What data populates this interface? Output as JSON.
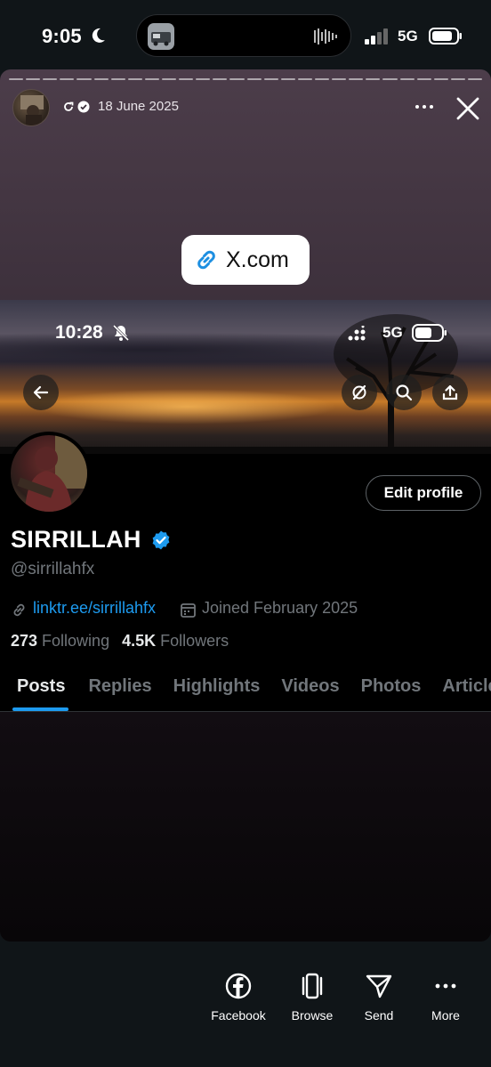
{
  "status_bar": {
    "time": "9:05",
    "network": "5G"
  },
  "story": {
    "date": "18 June 2025",
    "link_label": "X.com"
  },
  "inner_status": {
    "time": "10:28",
    "network": "5G"
  },
  "profile": {
    "edit_button": "Edit profile",
    "display_name": "SIRRILLAH",
    "handle": "@sirrillahfx",
    "link": "linktr.ee/sirrillahfx",
    "joined": "Joined February 2025",
    "following_count": "273",
    "following_label": "Following",
    "followers_count": "4.5K",
    "followers_label": "Followers"
  },
  "tabs": [
    {
      "label": "Posts"
    },
    {
      "label": "Replies"
    },
    {
      "label": "Highlights"
    },
    {
      "label": "Videos"
    },
    {
      "label": "Photos"
    },
    {
      "label": "Articles"
    }
  ],
  "actions": [
    {
      "label": "Facebook",
      "icon": "facebook-icon"
    },
    {
      "label": "Browse",
      "icon": "browse-icon"
    },
    {
      "label": "Send",
      "icon": "send-icon"
    },
    {
      "label": "More",
      "icon": "more-icon"
    }
  ],
  "colors": {
    "accent": "#1d9bf0",
    "muted": "#71767b",
    "background": "#101518"
  }
}
